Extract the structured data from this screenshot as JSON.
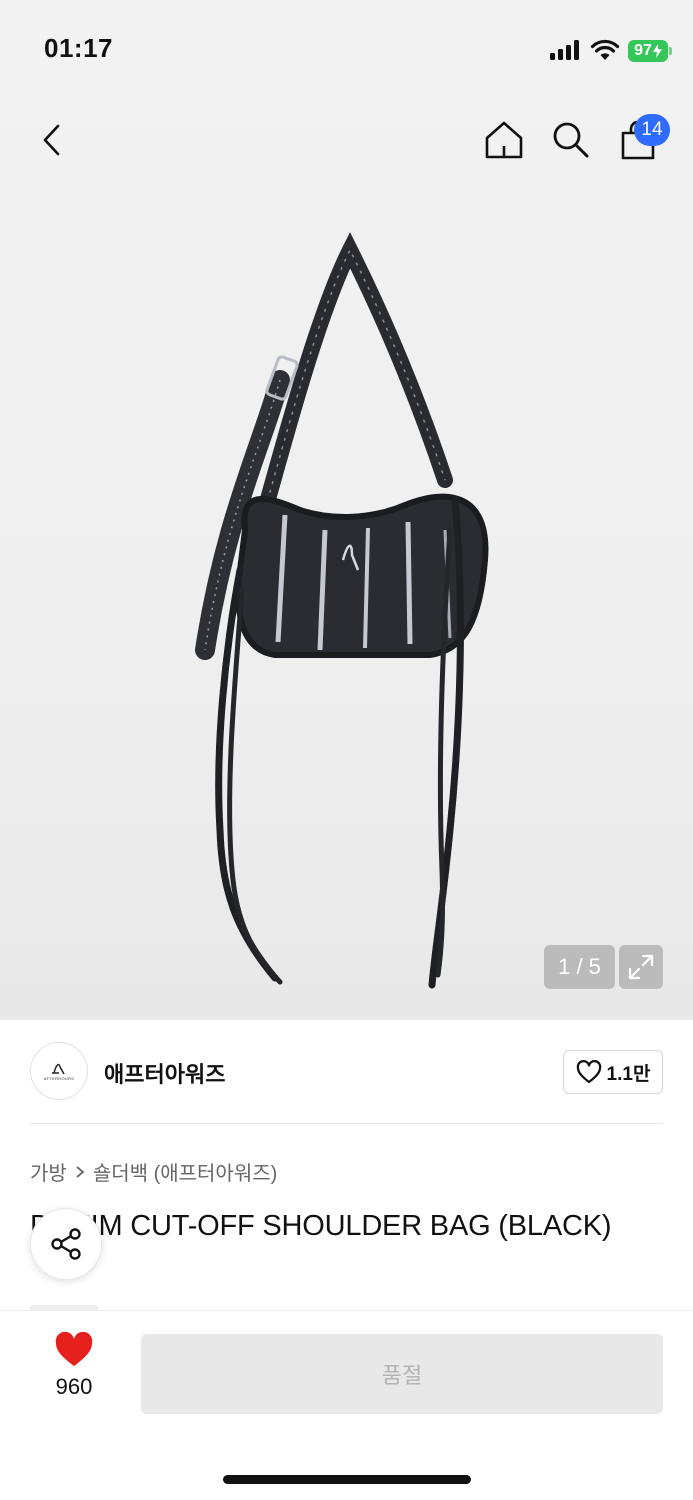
{
  "status_bar": {
    "time": "01:17",
    "battery": "97"
  },
  "nav": {
    "cart_count": "14"
  },
  "gallery": {
    "counter": "1 / 5"
  },
  "brand": {
    "name": "애프터아워즈",
    "logo_text": "AFTERHOURS",
    "likes": "1.1만"
  },
  "breadcrumb": {
    "category": "가방",
    "subcategory": "숄더백 (애프터아워즈)"
  },
  "product": {
    "title": "DENIM CUT-OFF SHOULDER BAG (BLACK)"
  },
  "bottom": {
    "wish_count": "960",
    "cta_label": "품절"
  },
  "colors": {
    "badge": "#2f6bff",
    "heart": "#e6201d",
    "battery": "#35c759"
  },
  "icons": [
    "back-icon",
    "home-icon",
    "search-icon",
    "cart-icon",
    "expand-icon",
    "heart-icon",
    "share-icon"
  ]
}
